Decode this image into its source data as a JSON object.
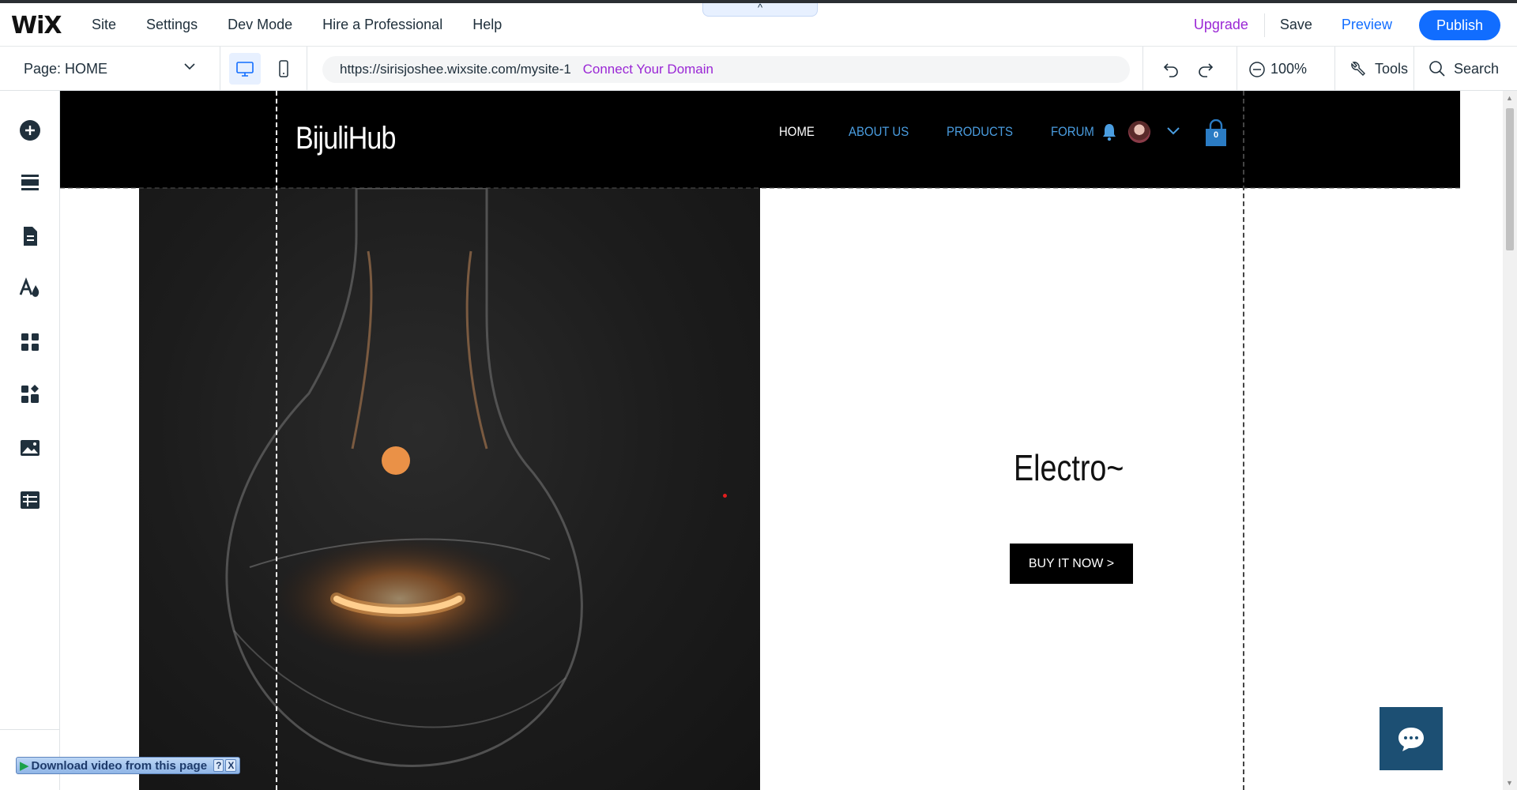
{
  "topbar": {
    "logo": "WiX",
    "menu": [
      "Site",
      "Settings",
      "Dev Mode",
      "Hire a Professional",
      "Help"
    ],
    "collapse_icon": "^",
    "upgrade": "Upgrade",
    "save": "Save",
    "preview": "Preview",
    "publish": "Publish"
  },
  "bar2": {
    "page_label": "Page: HOME",
    "url": "https://sirisjoshee.wixsite.com/mysite-1",
    "connect_domain": "Connect Your Domain",
    "zoom": "100%",
    "tools": "Tools",
    "search": "Search"
  },
  "leftrail": {
    "icons": [
      "add-elements-icon",
      "sections-icon",
      "pages-icon",
      "theme-icon",
      "apps-icon",
      "business-apps-icon",
      "media-icon",
      "cms-icon"
    ]
  },
  "site": {
    "logo": "BijuliHub",
    "nav": [
      "HOME",
      "ABOUT US",
      "PRODUCTS",
      "FORUM"
    ],
    "cart_count": "0",
    "headline": "Electro~",
    "cta": "BUY IT NOW >"
  },
  "overlay": {
    "download_text": "Download video from this page",
    "help": "?",
    "close": "X"
  },
  "colors": {
    "accent": "#116dff",
    "upgrade": "#9a27d5",
    "site_header": "#000000",
    "nav_link": "#4a9de0",
    "chat_button": "#1c4f73"
  }
}
